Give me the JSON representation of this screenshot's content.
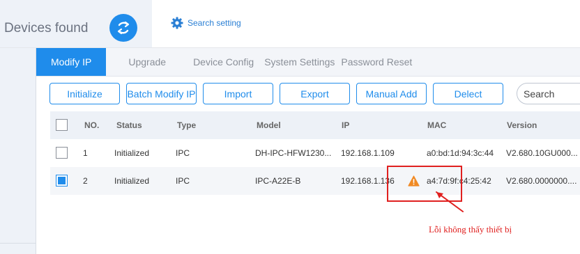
{
  "header": {
    "title": "Devices found",
    "refresh_icon": "refresh-icon",
    "search_setting_label": "Search setting",
    "search_setting_icon": "gear-icon"
  },
  "tabs": [
    {
      "label": "Modify IP",
      "active": true
    },
    {
      "label": "Upgrade",
      "active": false
    },
    {
      "label": "Device Config",
      "active": false
    },
    {
      "label": "System Settings",
      "active": false
    },
    {
      "label": "Password Reset",
      "active": false
    }
  ],
  "toolbar": {
    "initialize": "Initialize",
    "batch_modify_ip": "Batch Modify IP",
    "import": "Import",
    "export": "Export",
    "manual_add": "Manual Add",
    "delect": "Delect",
    "search_placeholder": "Search"
  },
  "table": {
    "columns": [
      "NO.",
      "Status",
      "Type",
      "Model",
      "IP",
      "MAC",
      "Version"
    ],
    "rows": [
      {
        "checked": false,
        "no": "1",
        "status": "Initialized",
        "type": "IPC",
        "model": "DH-IPC-HFW1230...",
        "ip": "192.168.1.109",
        "mac": "a0:bd:1d:94:3c:44",
        "version": "V2.680.10GU000..."
      },
      {
        "checked": true,
        "no": "2",
        "status": "Initialized",
        "type": "IPC",
        "model": "IPC-A22E-B",
        "ip": "192.168.1.136",
        "mac": "a4:7d:9f:c4:25:42",
        "version": "V2.680.0000000...."
      }
    ]
  },
  "annotation": {
    "note": "Lỗi không thấy thiết bị",
    "color": "#e0201f",
    "warning_icon": "warning-icon"
  },
  "colors": {
    "accent": "#1f8ceb",
    "panel": "#eef2f8"
  }
}
